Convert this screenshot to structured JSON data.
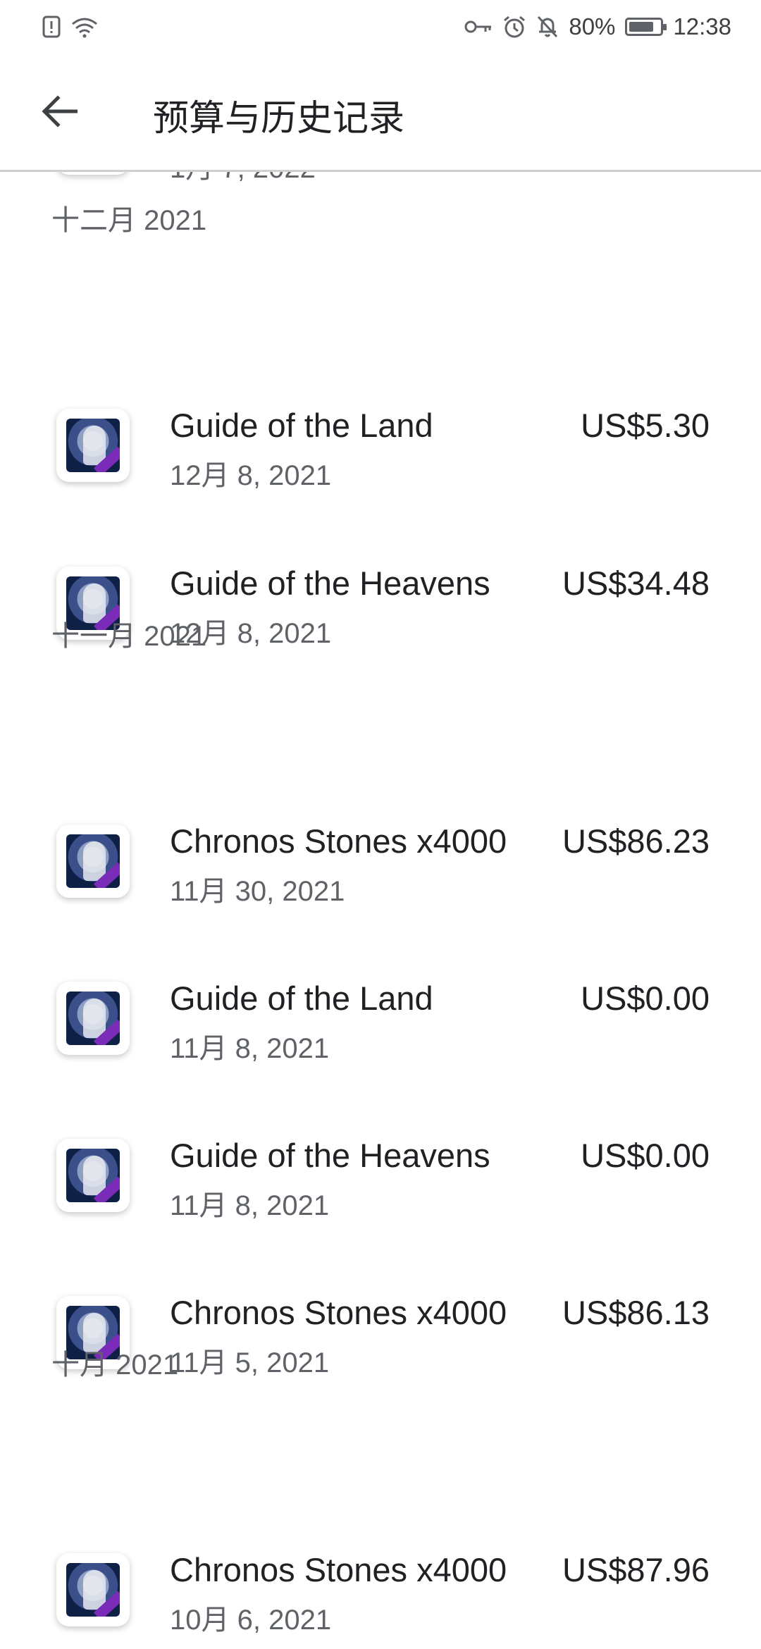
{
  "status_bar": {
    "battery": "80%",
    "battery_level": 0.8,
    "time": "12:38",
    "left_icons": [
      "alert-icon",
      "wifi-icon"
    ],
    "right_icons": [
      "key-icon",
      "alarm-icon",
      "bell-off-icon",
      "battery-icon"
    ]
  },
  "appbar": {
    "title": "预算与历史记录",
    "back_icon": "arrow-back-icon"
  },
  "partial_item": {
    "date": "1月 7, 2022"
  },
  "sections": [
    {
      "header": "十二月 2021",
      "items": [
        {
          "name": "Guide of the Land",
          "date": "12月 8, 2021",
          "price": "US$5.30"
        },
        {
          "name": "Guide of the Heavens",
          "date": "12月 8, 2021",
          "price": "US$34.48"
        }
      ]
    },
    {
      "header": "十一月 2021",
      "items": [
        {
          "name": "Chronos Stones x4000",
          "date": "11月 30, 2021",
          "price": "US$86.23"
        },
        {
          "name": "Guide of the Land",
          "date": "11月 8, 2021",
          "price": "US$0.00"
        },
        {
          "name": "Guide of the Heavens",
          "date": "11月 8, 2021",
          "price": "US$0.00"
        },
        {
          "name": "Chronos Stones x4000",
          "date": "11月 5, 2021",
          "price": "US$86.13"
        }
      ]
    },
    {
      "header": "十月 2021",
      "items": [
        {
          "name": "Chronos Stones x4000",
          "date": "10月 6, 2021",
          "price": "US$87.96"
        }
      ]
    }
  ],
  "colors": {
    "primary_text": "#202124",
    "secondary_text": "#5f6368",
    "divider": "#cfd0d2",
    "background": "#ffffff"
  }
}
